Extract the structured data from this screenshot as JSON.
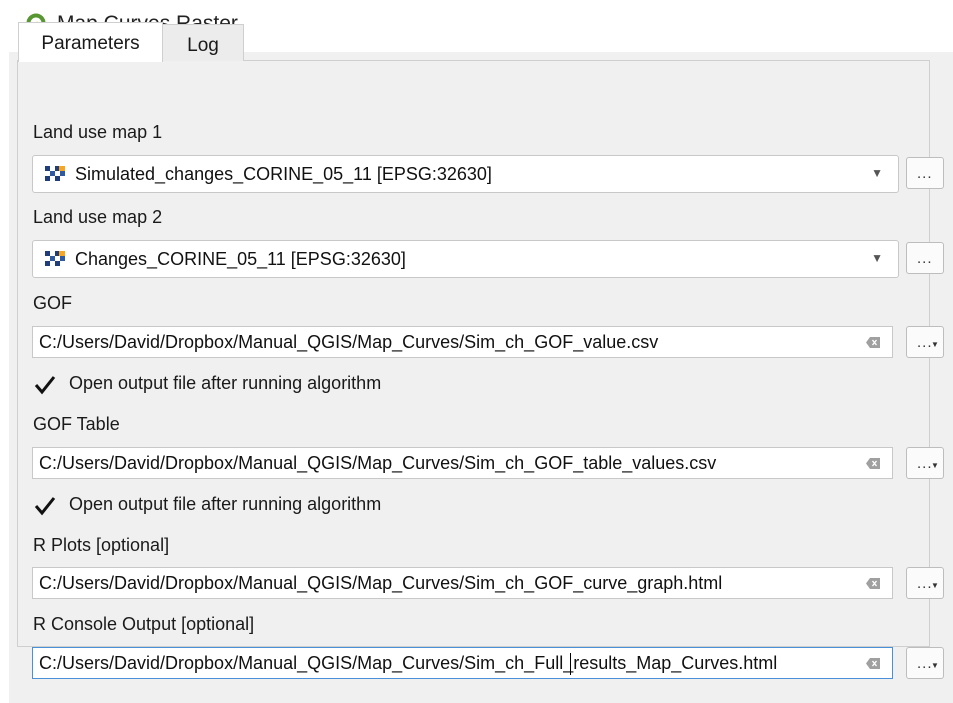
{
  "window": {
    "title": "Map Curves Raster",
    "app_icon": "qgis-logo-icon"
  },
  "tabs": [
    {
      "label": "Parameters",
      "active": true
    },
    {
      "label": "Log",
      "active": false
    }
  ],
  "params": {
    "land_use_1": {
      "label": "Land use map 1",
      "value": "Simulated_changes_CORINE_05_11 [EPSG:32630]",
      "icon": "raster-layer-icon"
    },
    "land_use_2": {
      "label": "Land use map 2",
      "value": "Changes_CORINE_05_11 [EPSG:32630]",
      "icon": "raster-layer-icon"
    },
    "gof": {
      "label": "GOF",
      "value": "C:/Users/David/Dropbox/Manual_QGIS/Map_Curves/Sim_ch_GOF_value.csv"
    },
    "gof_open": {
      "label": "Open output file after running algorithm",
      "checked": true
    },
    "gof_table": {
      "label": "GOF Table",
      "value": "C:/Users/David/Dropbox/Manual_QGIS/Map_Curves/Sim_ch_GOF_table_values.csv"
    },
    "gof_table_open": {
      "label": "Open output file after running algorithm",
      "checked": true
    },
    "r_plots": {
      "label": "R Plots [optional]",
      "value": "C:/Users/David/Dropbox/Manual_QGIS/Map_Curves/Sim_ch_GOF_curve_graph.html"
    },
    "r_console": {
      "label": "R Console Output [optional]",
      "value": "C:/Users/David/Dropbox/Manual_QGIS/Map_Curves/Sim_ch_Full_results_Map_Curves.html"
    }
  },
  "buttons": {
    "browse_label": "..."
  },
  "colors": {
    "qgis_green": "#589632",
    "qgis_yellow": "#ee7913",
    "focus_border": "#4a90d9"
  }
}
